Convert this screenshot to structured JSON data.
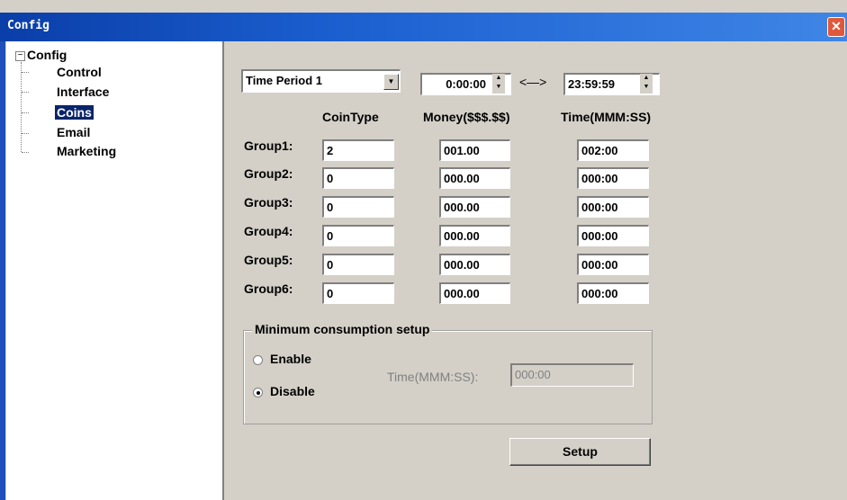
{
  "window": {
    "title": "Config",
    "close_glyph": "✕"
  },
  "tree": {
    "expander_glyph": "−",
    "root": "Config",
    "items": [
      "Control",
      "Interface",
      "Coins",
      "Email",
      "Marketing"
    ],
    "selected": "Coins"
  },
  "period": {
    "selected": "Time Period 1",
    "start": "0:00:00",
    "separator": "<—>",
    "end": "23:59:59"
  },
  "columns": {
    "coin_type": "CoinType",
    "money": "Money($$$.$$)",
    "time": "Time(MMM:SS)"
  },
  "groups": [
    {
      "label": "Group1:",
      "coin": "2",
      "money": "001.00",
      "time": "002:00"
    },
    {
      "label": "Group2:",
      "coin": "0",
      "money": "000.00",
      "time": "000:00"
    },
    {
      "label": "Group3:",
      "coin": "0",
      "money": "000.00",
      "time": "000:00"
    },
    {
      "label": "Group4:",
      "coin": "0",
      "money": "000.00",
      "time": "000:00"
    },
    {
      "label": "Group5:",
      "coin": "0",
      "money": "000.00",
      "time": "000:00"
    },
    {
      "label": "Group6:",
      "coin": "0",
      "money": "000.00",
      "time": "000:00"
    }
  ],
  "min_consumption": {
    "title": "Minimum consumption setup",
    "enable_label": "Enable",
    "disable_label": "Disable",
    "selected": "Disable",
    "time_label": "Time(MMM:SS):",
    "time_value": "000:00"
  },
  "setup_label": "Setup",
  "icons": {
    "dropdown": "▼",
    "spin_up": "▲",
    "spin_down": "▼"
  }
}
